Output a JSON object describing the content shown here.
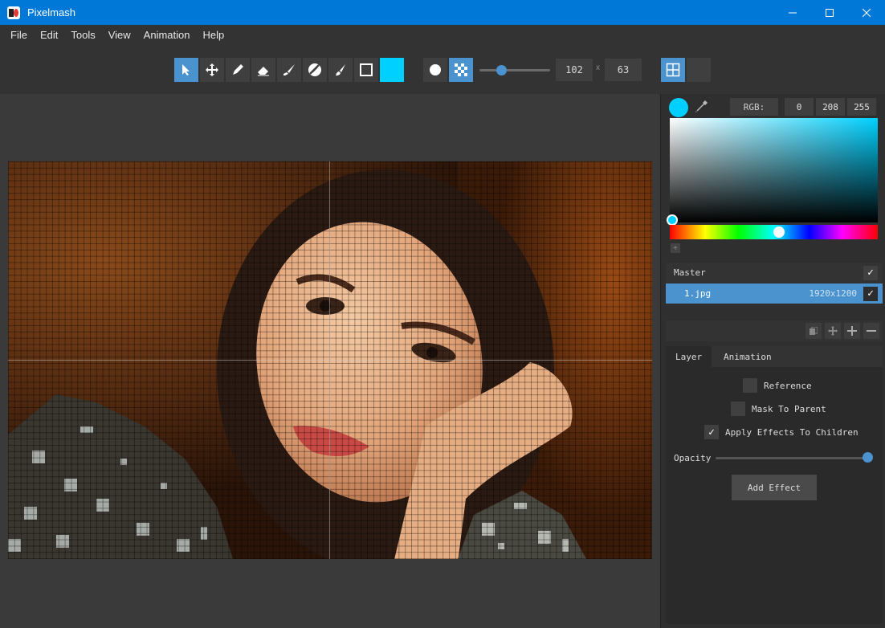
{
  "window": {
    "title": "Pixelmash"
  },
  "menu": [
    "File",
    "Edit",
    "Tools",
    "View",
    "Animation",
    "Help"
  ],
  "toolbar": {
    "tools": [
      "select-arrow-icon",
      "move-icon",
      "pencil-icon",
      "eraser-icon",
      "brush-icon",
      "fill-icon",
      "smudge-icon",
      "rectangle-icon"
    ],
    "active_tool": "select-arrow-icon",
    "current_color": "#00d0ff",
    "brush_shapes": [
      "circle-brush-icon",
      "dither-brush-icon"
    ],
    "active_brush_shape": "dither-brush-icon",
    "brush_size_fraction": 0.25,
    "width": "102",
    "times_label": "x",
    "height": "63",
    "grid_toggle_active": true
  },
  "color_picker": {
    "rgb_label": "RGB:",
    "r": "0",
    "g": "208",
    "b": "255",
    "color": "#00d0ff"
  },
  "layers": {
    "master": {
      "label": "Master",
      "visible": true
    },
    "items": [
      {
        "label": "1.jpg",
        "size": "1920x1200",
        "visible": true,
        "selected": true
      }
    ]
  },
  "tabs": {
    "layer": "Layer",
    "animation": "Animation"
  },
  "layer_props": {
    "reference": {
      "label": "Reference",
      "checked": false
    },
    "mask_to_parent": {
      "label": "Mask To Parent",
      "checked": false
    },
    "apply_effects": {
      "label": "Apply Effects To Children",
      "checked": true
    },
    "opacity_label": "Opacity",
    "opacity": 1.0,
    "add_effect": "Add Effect"
  }
}
